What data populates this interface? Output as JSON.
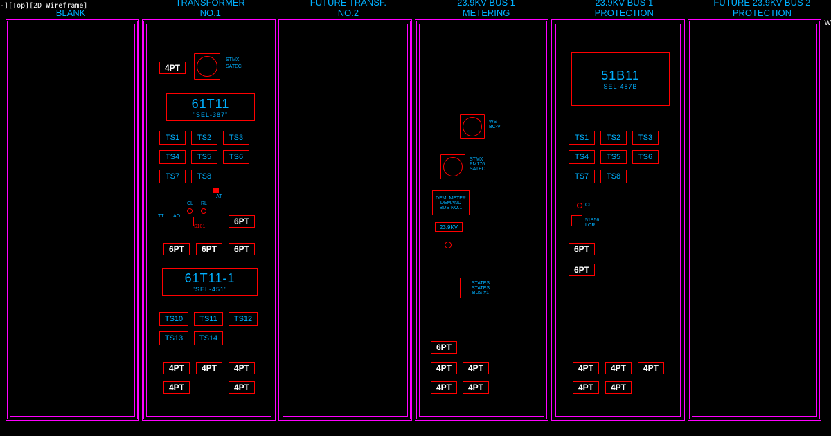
{
  "title_bar": "-][Top][2D Wireframe]",
  "wcs": "W",
  "headers": {
    "blank": "BLANK",
    "transformer1": "TRANSFORMER\nNO.1",
    "transformer2": "FUTURE TRANSF.\nNO.2",
    "metering": "23.9KV BUS 1\nMETERING",
    "protection1": "23.9KV BUS 1\nPROTECTION",
    "protection2": "FUTURE 23.9KV BUS 2\nPROTECTION"
  },
  "panel2": {
    "pt_top": "4PT",
    "sync_label1": "STMX",
    "sync_label2": "SATEC",
    "relay1": {
      "id": "61T11",
      "model": "\"SEL-387\""
    },
    "ts_row1": [
      "TS1",
      "TS2",
      "TS3"
    ],
    "ts_row2": [
      "TS4",
      "TS5",
      "TS6"
    ],
    "ts_row3": [
      "TS7",
      "TS8"
    ],
    "misc_labels": {
      "tt": "TT",
      "ao": "AO",
      "cl": "CL",
      "rl": "RL",
      "at": "AT",
      "s101": "S101"
    },
    "pt_mid1": "6PT",
    "pt_row_mid": [
      "6PT",
      "6PT",
      "6PT"
    ],
    "relay2": {
      "id": "61T11-1",
      "model": "\"SEL-451\""
    },
    "ts_row4": [
      "TS10",
      "TS11",
      "TS12"
    ],
    "ts_row5": [
      "TS13",
      "TS14"
    ],
    "pt_row_b1": [
      "4PT",
      "4PT",
      "4PT"
    ],
    "pt_row_b2": [
      "4PT",
      "",
      "4PT"
    ]
  },
  "panel4": {
    "label_ws": "WS\nBC-V",
    "label_stmx": "STMX\nPM176\nSATEC",
    "dem_meter": "DEM. METER\nDEMAND\nBUS NO.1",
    "voltage": "23.9KV",
    "states": "STATES\nSTATES\nBUS #1",
    "pt_6": "6PT",
    "pt_row1": [
      "4PT",
      "4PT"
    ],
    "pt_row2": [
      "4PT",
      "4PT"
    ]
  },
  "panel5": {
    "relay": {
      "id": "51B11",
      "model": "SEL-487B"
    },
    "ts_row1": [
      "TS1",
      "TS2",
      "TS3"
    ],
    "ts_row2": [
      "TS4",
      "TS5",
      "TS6"
    ],
    "ts_row3": [
      "TS7",
      "TS8"
    ],
    "cl": "CL",
    "lockout": "51B56\nLOR",
    "pt_6a": "6PT",
    "pt_6b": "6PT",
    "pt_row1": [
      "4PT",
      "4PT",
      "4PT"
    ],
    "pt_row2": [
      "4PT",
      "4PT"
    ]
  }
}
